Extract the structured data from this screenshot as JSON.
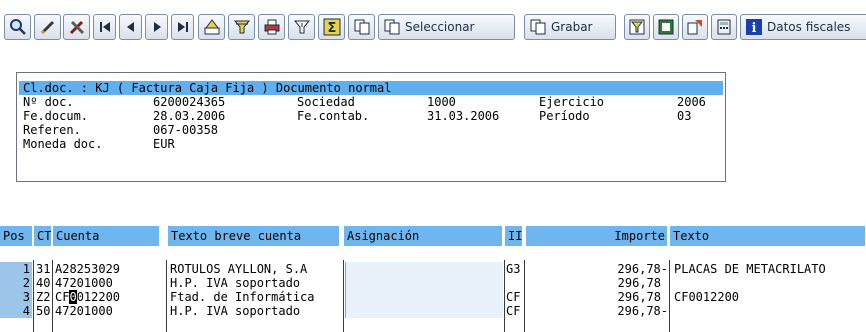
{
  "toolbar": {
    "buttons": [
      {
        "name": "zoom-icon"
      },
      {
        "name": "pencil-icon"
      },
      {
        "name": "tools-icon"
      },
      {
        "name": "first-page-icon"
      },
      {
        "name": "previous-page-icon"
      },
      {
        "name": "next-page-icon"
      },
      {
        "name": "last-page-icon"
      },
      {
        "name": "print-icon"
      },
      {
        "name": "filter-icon"
      },
      {
        "name": "printer-icon"
      },
      {
        "name": "set-filter-icon"
      },
      {
        "name": "sum-icon"
      },
      {
        "name": "copy-icon"
      }
    ],
    "seleccionar_label": "Seleccionar",
    "grabar_label": "Grabar",
    "datos_fiscales_label": "Datos fiscales"
  },
  "header": {
    "title": "Cl.doc. : KJ ( Factura Caja Fija ) Documento normal",
    "doc_no_label": "Nº doc.",
    "doc_no": "6200024365",
    "sociedad_label": "Sociedad",
    "sociedad": "1000",
    "ejercicio_label": "Ejercicio",
    "ejercicio": "2006",
    "fe_docum_label": "Fe.docum.",
    "fe_docum": "28.03.2006",
    "fe_contab_label": "Fe.contab.",
    "fe_contab": "31.03.2006",
    "periodo_label": "Período",
    "periodo": "03",
    "referen_label": "Referen.",
    "referen": "067-00358",
    "moneda_label": "Moneda doc.",
    "moneda": "EUR"
  },
  "table": {
    "columns": {
      "pos": "Pos",
      "ct": "CT",
      "cuenta": "Cuenta",
      "texto_breve": "Texto breve cuenta",
      "asignacion": "Asignación",
      "ii": "II",
      "importe": "Importe",
      "texto": "Texto"
    },
    "rows": [
      {
        "pos": "1",
        "ct": "31",
        "cuenta": "A28253029",
        "texto_breve": "ROTULOS AYLLON, S.A",
        "asignacion": "",
        "ii": "G3",
        "importe": "296,78-",
        "texto": "PLACAS DE METACRILATO"
      },
      {
        "pos": "2",
        "ct": "40",
        "cuenta": "47201000",
        "texto_breve": "H.P. IVA soportado",
        "asignacion": "",
        "ii": "",
        "importe": "296,78",
        "texto": ""
      },
      {
        "pos": "3",
        "ct": "Z2",
        "cuenta_pre": "CF",
        "cuenta_cursor": "0",
        "cuenta_post": "012200",
        "texto_breve": "Ftad. de Informática",
        "asignacion": "",
        "ii": "CF",
        "importe": "296,78",
        "texto": "CF0012200"
      },
      {
        "pos": "4",
        "ct": "50",
        "cuenta": "47201000",
        "texto_breve": "H.P. IVA soportado",
        "asignacion": "",
        "ii": "CF",
        "importe": "296,78-",
        "texto": ""
      }
    ]
  }
}
